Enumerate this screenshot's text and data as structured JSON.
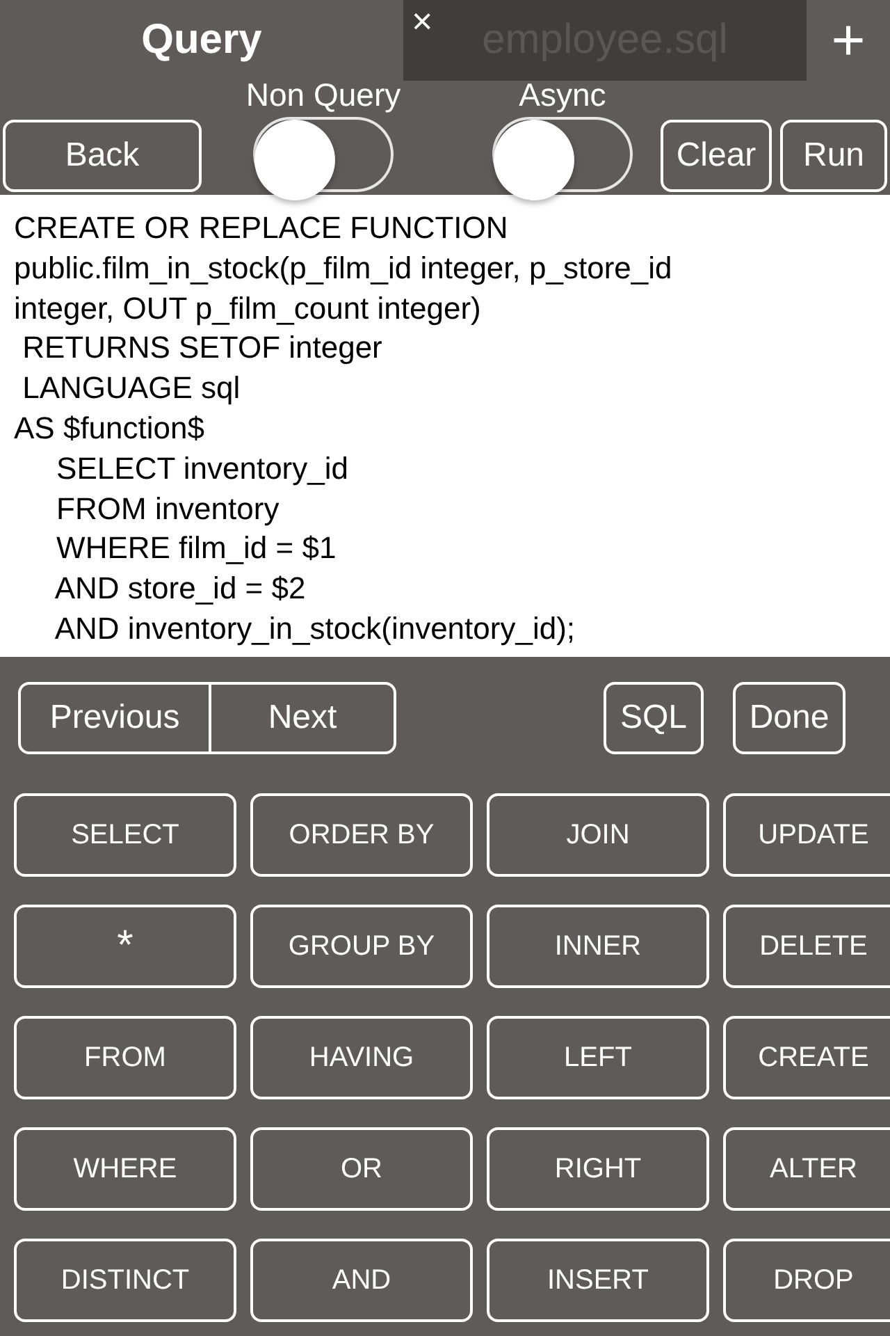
{
  "tabs": [
    {
      "label": "Query",
      "selected": true
    },
    {
      "label": "employee.sql",
      "selected": false,
      "close": "×"
    }
  ],
  "add_tab": "+",
  "toolbar": {
    "back": "Back",
    "toggles": [
      {
        "label": "Non Query",
        "on": false
      },
      {
        "label": "Async",
        "on": false
      }
    ],
    "buttons": [
      "Clear",
      "Run"
    ]
  },
  "editor_lines": [
    "CREATE OR REPLACE FUNCTION",
    "public.film_in_stock(p_film_id integer, p_store_id",
    "integer, OUT p_film_count integer)",
    " RETURNS SETOF integer",
    " LANGUAGE sql",
    "AS $function$",
    "     SELECT inventory_id",
    "     FROM inventory",
    "     WHERE film_id = $1",
    "     AND store_id = $2",
    "     AND inventory_in_stock(inventory_id);"
  ],
  "accessory": {
    "segments": [
      "Previous",
      "Next"
    ],
    "buttons": [
      "SQL",
      "Done"
    ]
  },
  "keys": [
    [
      "SELECT",
      "ORDER BY",
      "JOIN",
      "UPDATE"
    ],
    [
      "*",
      "GROUP BY",
      "INNER",
      "DELETE"
    ],
    [
      "FROM",
      "HAVING",
      "LEFT",
      "CREATE"
    ],
    [
      "WHERE",
      "OR",
      "RIGHT",
      "ALTER"
    ],
    [
      "DISTINCT",
      "AND",
      "INSERT",
      "DROP"
    ]
  ]
}
